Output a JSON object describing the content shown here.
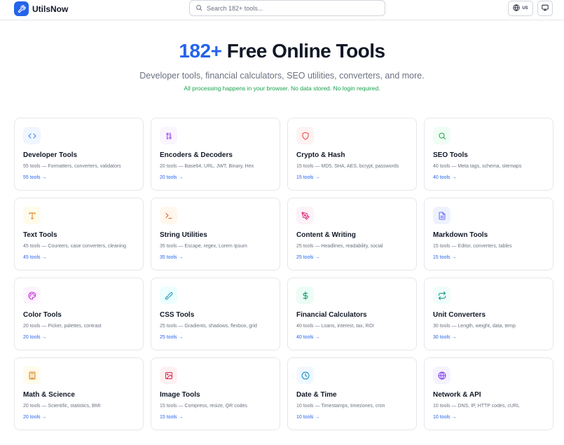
{
  "header": {
    "brand": "UtilsNow",
    "search_placeholder": "Search 182+ tools...",
    "lang_code": "US"
  },
  "hero": {
    "title_accent": "182+",
    "title_rest": " Free Online Tools",
    "subtitle": "Developer tools, financial calculators, SEO utilities, converters, and more.",
    "note": "All processing happens in your browser. No data stored. No login required."
  },
  "colors": {
    "accent": "#2563eb",
    "note_green": "#16a34a"
  },
  "categories": [
    {
      "title": "Developer Tools",
      "desc": "55 tools — Formatters, converters, validators",
      "link": "55 tools →",
      "icon": "code-icon",
      "color": "#3b82f6",
      "bg": "#eff6ff"
    },
    {
      "title": "Encoders & Decoders",
      "desc": "20 tools — Base64, URL, JWT, Binary, Hex",
      "link": "20 tools →",
      "icon": "binary-icon",
      "color": "#9333ea",
      "bg": "#faf5ff"
    },
    {
      "title": "Crypto & Hash",
      "desc": "15 tools — MD5, SHA, AES, bcrypt, passwords",
      "link": "15 tools →",
      "icon": "shield-icon",
      "color": "#ef4444",
      "bg": "#fef2f2"
    },
    {
      "title": "SEO Tools",
      "desc": "40 tools — Meta tags, schema, sitemaps",
      "link": "40 tools →",
      "icon": "search-icon",
      "color": "#16a34a",
      "bg": "#f0fdf4"
    },
    {
      "title": "Text Tools",
      "desc": "45 tools — Counters, case converters, cleaning",
      "link": "45 tools →",
      "icon": "type-icon",
      "color": "#d97706",
      "bg": "#fffbeb"
    },
    {
      "title": "String Utilities",
      "desc": "35 tools — Escape, regex, Lorem Ipsum",
      "link": "35 tools →",
      "icon": "terminal-icon",
      "color": "#ea580c",
      "bg": "#fff7ed"
    },
    {
      "title": "Content & Writing",
      "desc": "25 tools — Headlines, readability, social",
      "link": "25 tools →",
      "icon": "pen-tool-icon",
      "color": "#db2777",
      "bg": "#fdf2f8"
    },
    {
      "title": "Markdown Tools",
      "desc": "15 tools — Editor, converters, tables",
      "link": "15 tools →",
      "icon": "file-text-icon",
      "color": "#6366f1",
      "bg": "#eef2ff"
    },
    {
      "title": "Color Tools",
      "desc": "20 tools — Picker, palettes, contrast",
      "link": "20 tools →",
      "icon": "palette-icon",
      "color": "#c026d3",
      "bg": "#fdf4ff"
    },
    {
      "title": "CSS Tools",
      "desc": "25 tools — Gradients, shadows, flexbox, grid",
      "link": "25 tools →",
      "icon": "brush-icon",
      "color": "#0891b2",
      "bg": "#ecfeff"
    },
    {
      "title": "Financial Calculators",
      "desc": "40 tools — Loans, interest, tax, ROI",
      "link": "40 tools →",
      "icon": "dollar-icon",
      "color": "#059669",
      "bg": "#ecfdf5"
    },
    {
      "title": "Unit Converters",
      "desc": "30 tools — Length, weight, data, temp",
      "link": "30 tools →",
      "icon": "arrows-swap-icon",
      "color": "#0d9488",
      "bg": "#f0fdfa"
    },
    {
      "title": "Math & Science",
      "desc": "20 tools — Scientific, statistics, BMI",
      "link": "20 tools →",
      "icon": "calculator-icon",
      "color": "#d97706",
      "bg": "#fffbeb"
    },
    {
      "title": "Image Tools",
      "desc": "15 tools — Compress, resize, QR codes",
      "link": "15 tools →",
      "icon": "image-icon",
      "color": "#e11d48",
      "bg": "#fff1f2"
    },
    {
      "title": "Date & Time",
      "desc": "10 tools — Timestamps, timezones, cron",
      "link": "10 tools →",
      "icon": "clock-icon",
      "color": "#0284c7",
      "bg": "#f0f9ff"
    },
    {
      "title": "Network & API",
      "desc": "10 tools — DNS, IP, HTTP codes, cURL",
      "link": "10 tools →",
      "icon": "globe-icon",
      "color": "#7c3aed",
      "bg": "#f5f3ff"
    }
  ]
}
